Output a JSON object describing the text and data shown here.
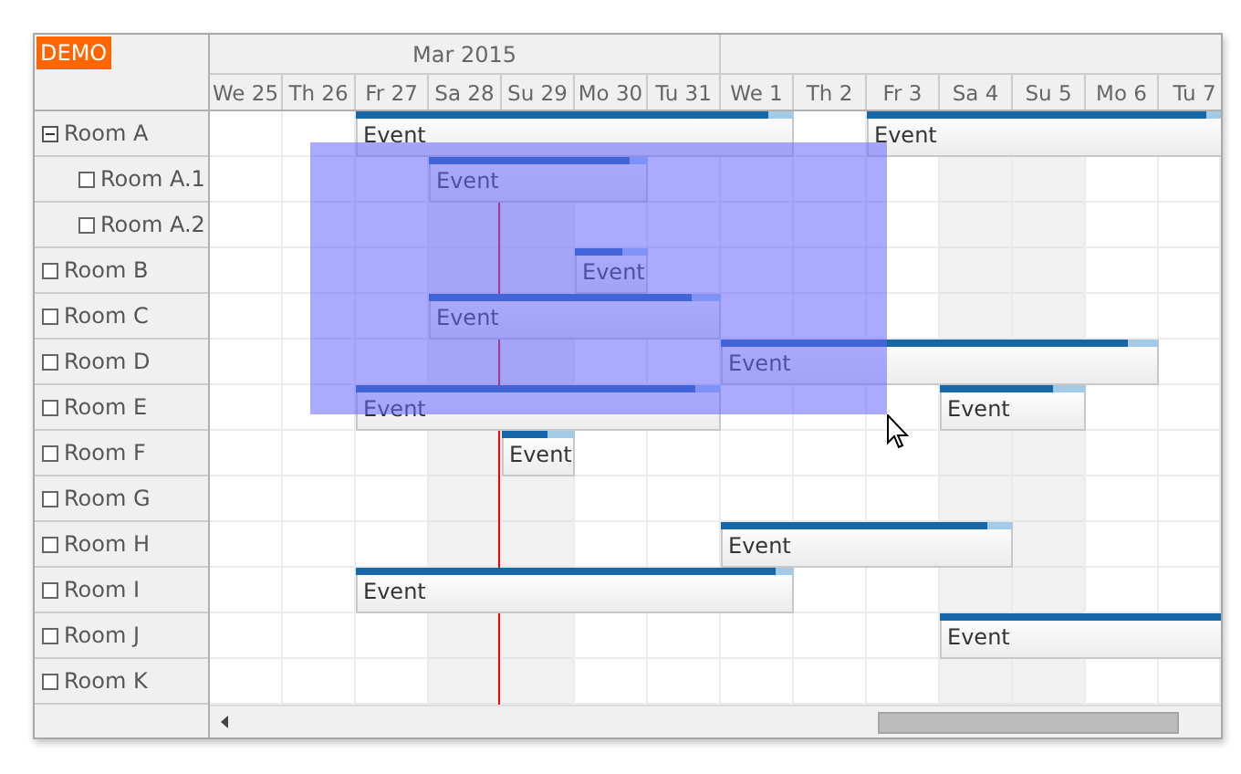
{
  "badge": "DEMO",
  "months": [
    "Mar 2015"
  ],
  "days": [
    {
      "label": "We 25",
      "weekend": false
    },
    {
      "label": "Th 26",
      "weekend": false
    },
    {
      "label": "Fr 27",
      "weekend": false
    },
    {
      "label": "Sa 28",
      "weekend": true
    },
    {
      "label": "Su 29",
      "weekend": true
    },
    {
      "label": "Mo 30",
      "weekend": false
    },
    {
      "label": "Tu 31",
      "weekend": false
    },
    {
      "label": "We 1",
      "weekend": false
    },
    {
      "label": "Th 2",
      "weekend": false
    },
    {
      "label": "Fr 3",
      "weekend": false
    },
    {
      "label": "Sa 4",
      "weekend": true
    },
    {
      "label": "Su 5",
      "weekend": true
    },
    {
      "label": "Mo 6",
      "weekend": false
    },
    {
      "label": "Tu 7",
      "weekend": false
    }
  ],
  "resources": [
    {
      "name": "Room A",
      "expanded": true,
      "events": [
        {
          "text": "Event",
          "level": 0.94
        },
        {
          "text": "Event",
          "level": 0.93
        }
      ],
      "children": [
        {
          "name": "Room A.1",
          "expanded": false,
          "events": [
            {
              "text": "Event",
              "level": 0.92
            }
          ]
        },
        {
          "name": "Room A.2",
          "expanded": false
        }
      ]
    },
    {
      "name": "Room B",
      "expanded": false,
      "events": [
        {
          "text": "Event",
          "level": 0.65
        }
      ]
    },
    {
      "name": "Room C",
      "expanded": false,
      "events": [
        {
          "text": "Event",
          "level": 0.9
        }
      ]
    },
    {
      "name": "Room D",
      "expanded": false,
      "events": [
        {
          "text": "Event",
          "level": 0.93
        }
      ]
    },
    {
      "name": "Room E",
      "expanded": false,
      "events": [
        {
          "text": "Event",
          "level": 0.93
        },
        {
          "text": "Event",
          "level": 0.78
        }
      ]
    },
    {
      "name": "Room F",
      "expanded": false,
      "events": [
        {
          "text": "Event",
          "level": 0.62
        }
      ]
    },
    {
      "name": "Room G",
      "expanded": false
    },
    {
      "name": "Room H",
      "expanded": false,
      "events": [
        {
          "text": "Event",
          "level": 0.91
        }
      ]
    },
    {
      "name": "Room I",
      "expanded": false,
      "events": [
        {
          "text": "Event",
          "level": 0.96
        }
      ]
    },
    {
      "name": "Room J",
      "expanded": false,
      "events": [
        {
          "text": "Event",
          "level": 1
        }
      ]
    },
    {
      "name": "Room K",
      "expanded": false
    }
  ]
}
